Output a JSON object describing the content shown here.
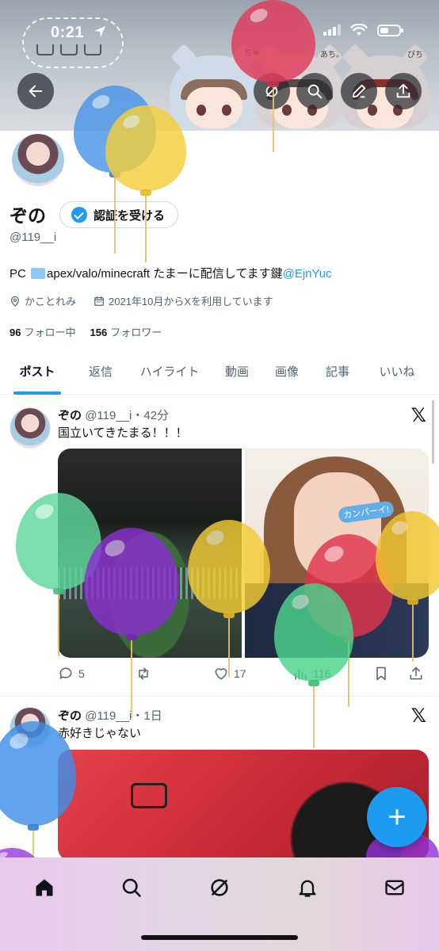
{
  "status_bar": {
    "time": "0:21"
  },
  "banner": {
    "note_left": "ちゃ",
    "note_mid": "あち。",
    "note_right": "ぴち"
  },
  "profile": {
    "name": "ぞの",
    "verify_label": "認証を受ける",
    "handle": "@119__i",
    "bio_prefix": "PC",
    "bio_body": "apex/valo/minecraft たまーに配信してます鍵",
    "bio_link": "@EjnYuc",
    "location": "かことれみ",
    "joined": "2021年10月からXを利用しています",
    "following_count": "96",
    "following_label": "フォロー中",
    "followers_count": "156",
    "followers_label": "フォロワー"
  },
  "tabs": [
    {
      "label": "ポスト",
      "active": true
    },
    {
      "label": "返信"
    },
    {
      "label": "ハイライト"
    },
    {
      "label": "動画"
    },
    {
      "label": "画像"
    },
    {
      "label": "記事"
    },
    {
      "label": "いいね"
    }
  ],
  "posts": [
    {
      "name": "ぞの",
      "handle": "@119__i",
      "time": "・42分",
      "text": "国立いてきたまる！！！",
      "sticker": "カンパーイ!",
      "replies": "5",
      "retweets": "",
      "likes": "17",
      "views": "116"
    },
    {
      "name": "ぞの",
      "handle": "@119__i",
      "time": "・1日",
      "text": "赤好きじゃない"
    }
  ],
  "fab_label": "+",
  "icons": {
    "back": "arrow-left-icon",
    "search": "search-icon",
    "edit": "pencil-icon",
    "share": "share-icon",
    "home": "home-icon",
    "explore": "search-icon",
    "grok": "grok-icon",
    "notifications": "bell-icon",
    "messages": "mail-icon"
  },
  "colors": {
    "accent": "#1d9bf0",
    "text": "#0f1419",
    "secondary": "#536471"
  }
}
